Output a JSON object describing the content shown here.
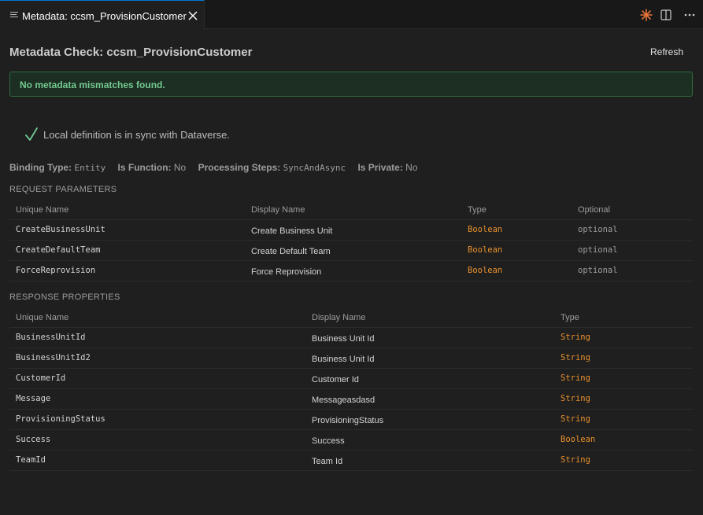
{
  "tab": {
    "title": "Metadata: ccsm_ProvisionCustomer"
  },
  "header": {
    "title": "Metadata Check: ccsm_ProvisionCustomer",
    "refresh_label": "Refresh"
  },
  "banner": {
    "text": "No metadata mismatches found."
  },
  "sync": {
    "text": "Local definition is in sync with Dataverse."
  },
  "meta": {
    "binding_type_label": "Binding Type:",
    "binding_type_value": "Entity",
    "is_function_label": "Is Function:",
    "is_function_value": "No",
    "processing_steps_label": "Processing Steps:",
    "processing_steps_value": "SyncAndAsync",
    "is_private_label": "Is Private:",
    "is_private_value": "No"
  },
  "request": {
    "heading": "REQUEST PARAMETERS",
    "columns": [
      "Unique Name",
      "Display Name",
      "Type",
      "Optional"
    ],
    "rows": [
      {
        "unique": "CreateBusinessUnit",
        "display": "Create Business Unit",
        "type": "Boolean",
        "optional": "optional"
      },
      {
        "unique": "CreateDefaultTeam",
        "display": "Create Default Team",
        "type": "Boolean",
        "optional": "optional"
      },
      {
        "unique": "ForceReprovision",
        "display": "Force Reprovision",
        "type": "Boolean",
        "optional": "optional"
      }
    ]
  },
  "response": {
    "heading": "RESPONSE PROPERTIES",
    "columns": [
      "Unique Name",
      "Display Name",
      "Type"
    ],
    "rows": [
      {
        "unique": "BusinessUnitId",
        "display": "Business Unit Id",
        "type": "String"
      },
      {
        "unique": "BusinessUnitId2",
        "display": "Business Unit Id",
        "type": "String"
      },
      {
        "unique": "CustomerId",
        "display": "Customer Id",
        "type": "String"
      },
      {
        "unique": "Message",
        "display": "Messageasdasd",
        "type": "String"
      },
      {
        "unique": "ProvisioningStatus",
        "display": "ProvisioningStatus",
        "type": "String"
      },
      {
        "unique": "Success",
        "display": "Success",
        "type": "Boolean"
      },
      {
        "unique": "TeamId",
        "display": "Team Id",
        "type": "String"
      }
    ]
  },
  "colors": {
    "accent": "#0078d4",
    "success": "#73c991",
    "type": "#e8902e"
  },
  "icons": [
    "file-lines-icon",
    "close-icon",
    "sparkle-icon",
    "split-editor-icon",
    "more-actions-icon",
    "checkmark-icon"
  ]
}
